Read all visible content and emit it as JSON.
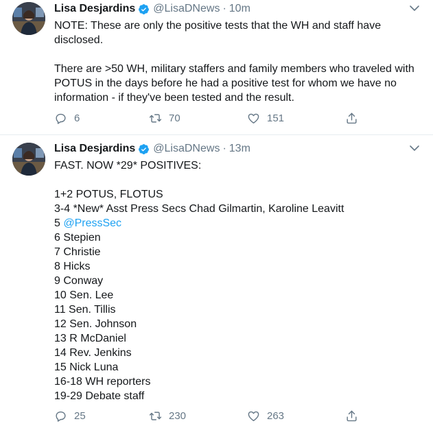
{
  "tweets": [
    {
      "author_name": "Lisa Desjardins",
      "handle": "@LisaDNews",
      "separator": "·",
      "time": "10m",
      "paragraphs": [
        "NOTE: These are only the positive tests that the WH and staff have disclosed.",
        "There are >50 WH, military staffers and family members who traveled with POTUS in the days before he had a positive test for whom we have no information - if they've been tested and the result."
      ],
      "reply_count": "6",
      "retweet_count": "70",
      "like_count": "151"
    },
    {
      "author_name": "Lisa Desjardins",
      "handle": "@LisaDNews",
      "separator": "·",
      "time": "13m",
      "intro": "FAST. NOW *29* POSITIVES:",
      "list": [
        "1+2 POTUS, FLOTUS",
        "3-4 *New* Asst Press Secs Chad Gilmartin, Karoline Leavitt",
        "6 Stepien",
        "7 Christie",
        "8 Hicks",
        "9 Conway",
        "10 Sen. Lee",
        "11 Sen. Tillis",
        "12 Sen. Johnson",
        "13 R McDaniel",
        "14 Rev. Jenkins",
        "15 Nick Luna",
        "16-18 WH reporters",
        "19-29 Debate staff"
      ],
      "line5_prefix": "5 ",
      "line5_mention": "@PressSec",
      "reply_count": "25",
      "retweet_count": "230",
      "like_count": "263"
    }
  ],
  "colors": {
    "text": "#14171a",
    "secondary": "#657786",
    "link": "#1da1f2",
    "verified": "#1da1f2",
    "divider": "#e6ecf0"
  },
  "icons": {
    "reply": "reply-icon",
    "retweet": "retweet-icon",
    "like": "like-icon",
    "share": "share-icon",
    "verified": "verified-badge-icon",
    "more": "chevron-down-icon"
  }
}
